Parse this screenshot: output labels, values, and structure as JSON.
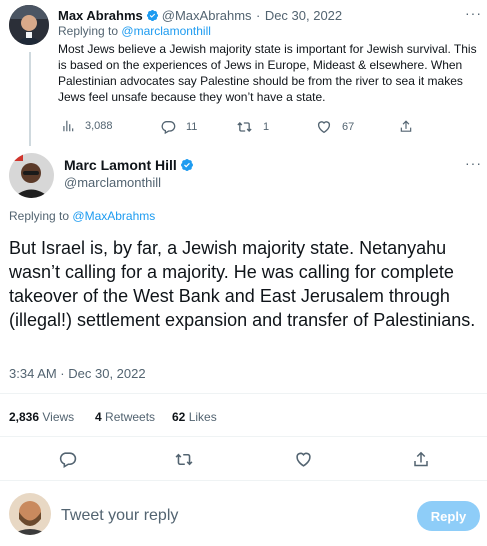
{
  "parent_tweet": {
    "author_name": "Max Abrahms",
    "handle": "@MaxAbrahms",
    "separator": "·",
    "date": "Dec 30, 2022",
    "replying_prefix": "Replying to",
    "replying_handle": "@marclamonthill",
    "text": "Most Jews believe a Jewish majority state is important for Jewish survival. This is based on the experiences of Jews in Europe, Mideast & elsewhere. When Palestinian advocates say Palestine should be from the river to sea it makes Jews feel unsafe because they won’t have a state.",
    "views": "3,088",
    "replies": "11",
    "retweets": "1",
    "likes": "67"
  },
  "main_tweet": {
    "author_name": "Marc Lamont Hill",
    "handle": "@marclamonthill",
    "replying_prefix": "Replying to",
    "replying_handle": "@MaxAbrahms",
    "text": "But Israel is, by far, a Jewish majority state. Netanyahu wasn’t calling for a majority. He was calling for complete takeover of the West Bank and East Jerusalem through (illegal!) settlement expansion and transfer of Palestinians.",
    "timestamp": "3:34 AM · Dec 30, 2022",
    "stats": {
      "views_count": "2,836",
      "views_label": "Views",
      "retweets_count": "4",
      "retweets_label": "Retweets",
      "likes_count": "62",
      "likes_label": "Likes"
    }
  },
  "composer": {
    "placeholder": "Tweet your reply",
    "button_label": "Reply"
  },
  "more_label": "···",
  "colors": {
    "accent": "#1d9bf0",
    "secondary_text": "#536471",
    "divider": "#eff3f4",
    "reply_button_disabled": "#8ecdf8"
  }
}
